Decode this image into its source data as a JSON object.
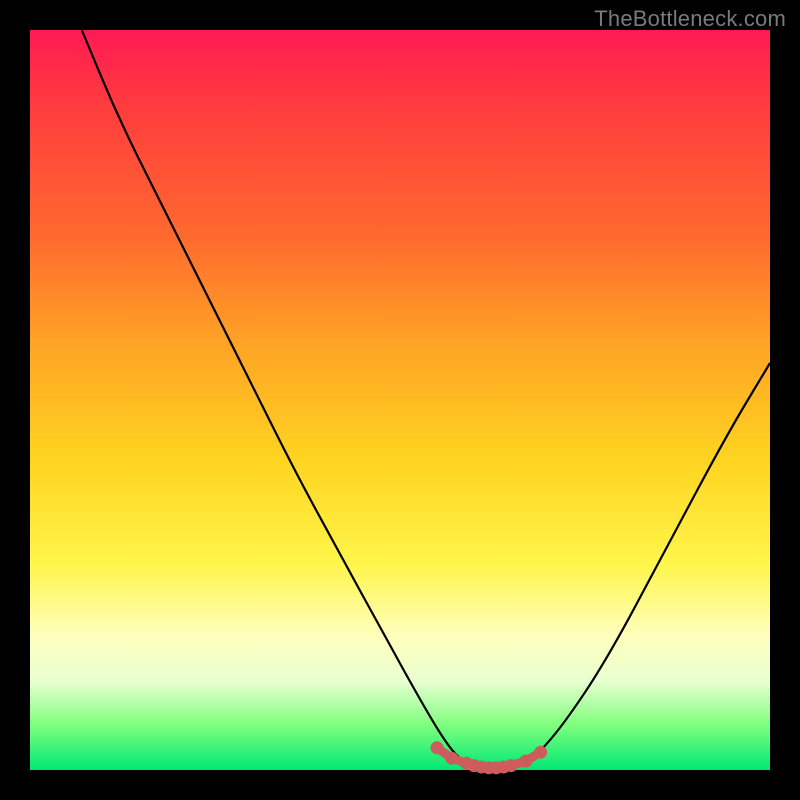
{
  "watermark": "TheBottleneck.com",
  "colors": {
    "curve_stroke": "#000000",
    "marker_stroke": "#cf5c5c",
    "marker_fill": "#cf5c5c"
  },
  "chart_data": {
    "type": "line",
    "title": "",
    "xlabel": "",
    "ylabel": "",
    "xlim": [
      0,
      100
    ],
    "ylim": [
      0,
      100
    ],
    "series": [
      {
        "name": "bottleneck-curve",
        "x": [
          7,
          12,
          18,
          24,
          30,
          36,
          42,
          48,
          53,
          56,
          58,
          60,
          62,
          64,
          66,
          68,
          72,
          78,
          86,
          94,
          100
        ],
        "values": [
          100,
          88,
          76,
          64,
          52,
          40,
          29,
          18,
          9,
          4,
          1.5,
          0.6,
          0.3,
          0.3,
          0.6,
          1.5,
          6,
          15,
          30,
          45,
          55
        ]
      },
      {
        "name": "optimal-markers",
        "x": [
          55,
          57,
          59,
          60,
          61,
          62,
          63,
          64,
          65,
          67,
          69
        ],
        "values": [
          3.0,
          1.6,
          0.9,
          0.6,
          0.4,
          0.3,
          0.3,
          0.4,
          0.6,
          1.2,
          2.4
        ]
      }
    ]
  }
}
